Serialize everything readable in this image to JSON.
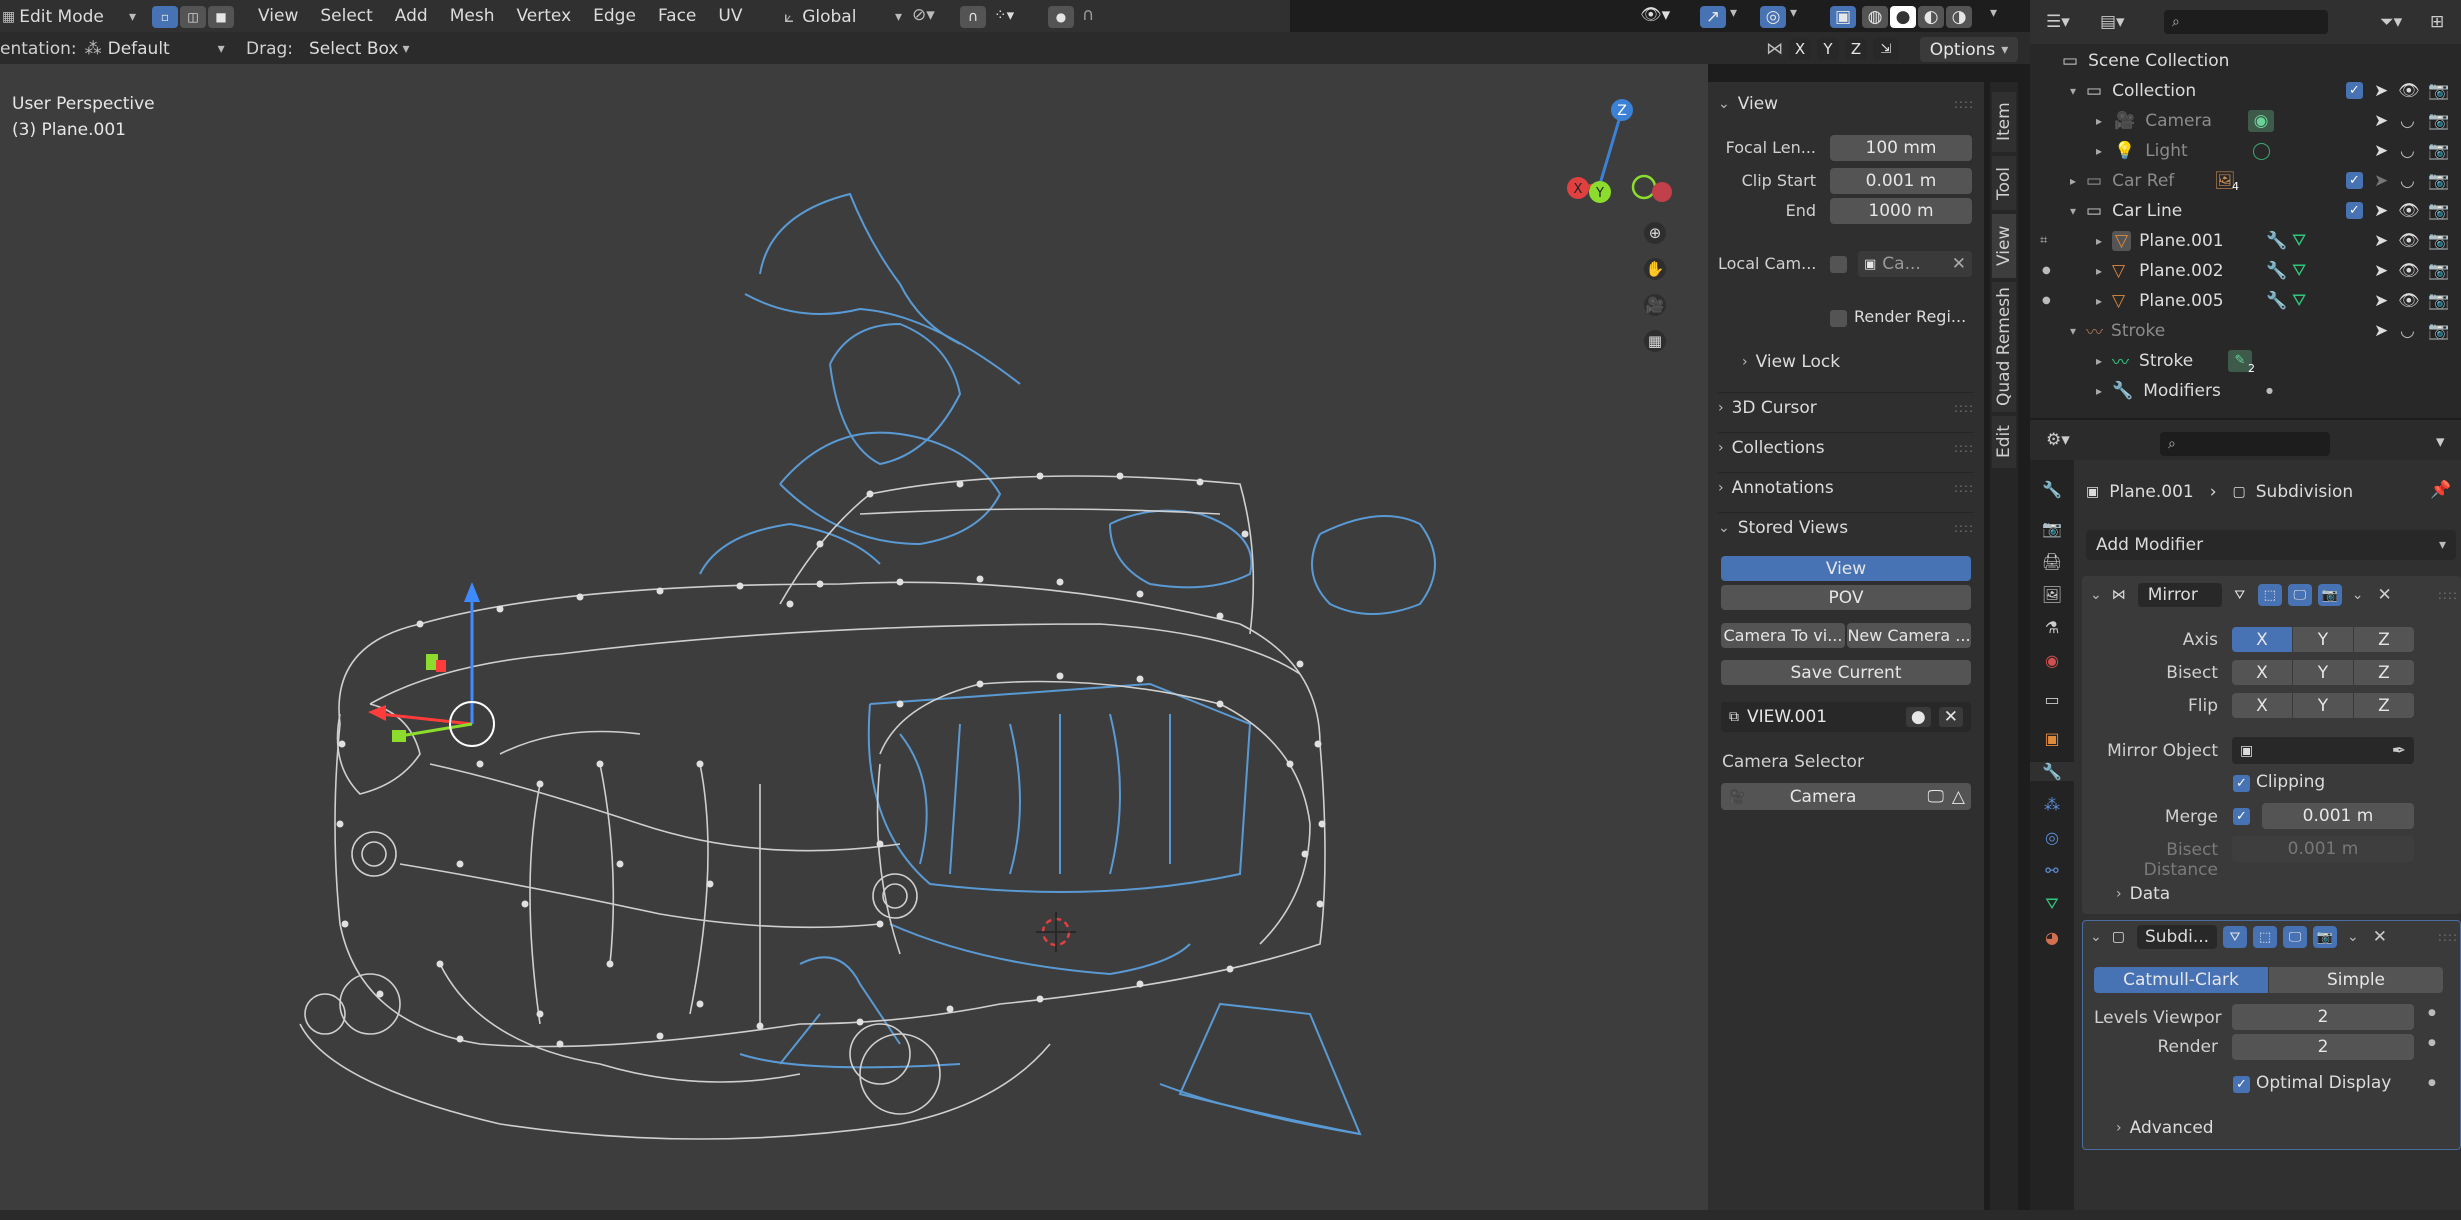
{
  "header": {
    "mode": "Edit Mode",
    "menus": [
      "View",
      "Select",
      "Add",
      "Mesh",
      "Vertex",
      "Edge",
      "Face",
      "UV"
    ],
    "transform_space": "Global"
  },
  "toolbar2": {
    "orientation_label": "entation:",
    "orientation_value": "Default",
    "drag_label": "Drag:",
    "drag_value": "Select Box",
    "axes": [
      "X",
      "Y",
      "Z"
    ],
    "options_label": "Options"
  },
  "viewport": {
    "perspective": "User Perspective",
    "object": "(3) Plane.001",
    "gizmo": {
      "z": "Z",
      "y": "Y",
      "x": "X"
    }
  },
  "npanel": {
    "tabs": [
      "Item",
      "Tool",
      "View",
      "Quad Remesh",
      "Edit"
    ],
    "view_header": "View",
    "focal_label": "Focal Len...",
    "focal_value": "100 mm",
    "clip_start_label": "Clip Start",
    "clip_start_value": "0.001 m",
    "clip_end_label": "End",
    "clip_end_value": "1000 m",
    "local_cam_label": "Local Cam...",
    "local_cam_value": "Ca...",
    "render_region_label": "Render Regi...",
    "view_lock": "View Lock",
    "sections": [
      "3D Cursor",
      "Collections",
      "Annotations"
    ],
    "stored_views_header": "Stored Views",
    "stored_buttons": {
      "view": "View",
      "pov": "POV",
      "camera_to": "Camera To vi...",
      "new_camera": "New Camera ...",
      "save_current": "Save Current"
    },
    "view_name": "VIEW.001",
    "camera_selector_label": "Camera Selector",
    "camera_value": "Camera"
  },
  "outliner": {
    "rows": [
      {
        "label": "Scene Collection",
        "indent": 0
      },
      {
        "label": "Collection",
        "indent": 1
      },
      {
        "label": "Camera",
        "indent": 2
      },
      {
        "label": "Light",
        "indent": 2
      },
      {
        "label": "Car Ref",
        "indent": 1
      },
      {
        "label": "Car Line",
        "indent": 1
      },
      {
        "label": "Plane.001",
        "indent": 2
      },
      {
        "label": "Plane.002",
        "indent": 2
      },
      {
        "label": "Plane.005",
        "indent": 2
      },
      {
        "label": "Stroke",
        "indent": 1
      },
      {
        "label": "Stroke",
        "indent": 2
      },
      {
        "label": "Modifiers",
        "indent": 2
      }
    ],
    "car_ref_badge": "4",
    "stroke_badge": "2"
  },
  "properties": {
    "breadcrumb_object": "Plane.001",
    "breadcrumb_modifier": "Subdivision",
    "add_modifier": "Add Modifier",
    "mirror": {
      "name": "Mirror",
      "axis_label": "Axis",
      "bisect_label": "Bisect",
      "flip_label": "Flip",
      "xyz": [
        "X",
        "Y",
        "Z"
      ],
      "mirror_object_label": "Mirror Object",
      "clipping_label": "Clipping",
      "merge_label": "Merge",
      "merge_value": "0.001 m",
      "bisect_distance_label": "Bisect Distance",
      "bisect_distance_value": "0.001 m",
      "data_label": "Data"
    },
    "subdivision": {
      "name": "Subdi...",
      "catmull": "Catmull-Clark",
      "simple": "Simple",
      "levels_label": "Levels Viewpor",
      "levels_value": "2",
      "render_label": "Render",
      "render_value": "2",
      "optimal_label": "Optimal Display",
      "advanced_label": "Advanced"
    }
  },
  "colors": {
    "accent": "#4772b3",
    "panel": "#303030",
    "viewport": "#3d3d3d",
    "sketch": "#5a9ad4"
  }
}
